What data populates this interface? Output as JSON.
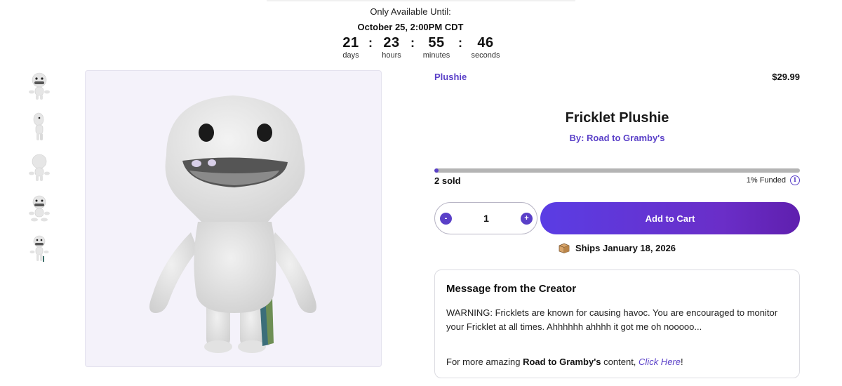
{
  "countdown": {
    "label": "Only Available Until:",
    "date": "October 25, 2:00PM CDT",
    "units": [
      {
        "value": "21",
        "label": "days"
      },
      {
        "value": "23",
        "label": "hours"
      },
      {
        "value": "55",
        "label": "minutes"
      },
      {
        "value": "46",
        "label": "seconds"
      }
    ],
    "separator": ":"
  },
  "thumbnails": [
    {
      "name": "thumbnail-front"
    },
    {
      "name": "thumbnail-side"
    },
    {
      "name": "thumbnail-back"
    },
    {
      "name": "thumbnail-front-sitting"
    },
    {
      "name": "thumbnail-standing"
    }
  ],
  "product": {
    "category": "Plushie",
    "price": "$29.99",
    "title": "Fricklet Plushie",
    "byline": "By: Road to Gramby's",
    "sold": "2 sold",
    "funded_text": "1% Funded",
    "funded_fraction": 0.01,
    "info_icon": "i",
    "quantity": "1",
    "minus": "-",
    "plus": "+",
    "add_to_cart": "Add to Cart",
    "ships": "Ships January 18, 2026"
  },
  "message": {
    "title": "Message from the Creator",
    "body": "WARNING: Fricklets are known for causing havoc. You are encouraged to monitor your Fricklet at all times. Ahhhhhh ahhhh it got me oh nooooo...",
    "footer_prefix": "For more amazing ",
    "footer_brand": "Road to Gramby's",
    "footer_middle": " content, ",
    "footer_link": "Click Here",
    "footer_suffix": "!"
  },
  "colors": {
    "accent": "#5a40c8",
    "button_start": "#5a3de4",
    "button_end": "#5f1fae",
    "image_bg": "#f4f2fa"
  }
}
